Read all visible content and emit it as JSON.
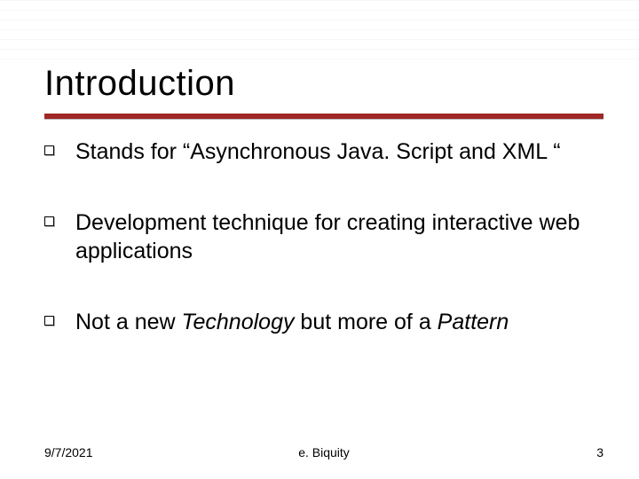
{
  "title": "Introduction",
  "bullets": [
    {
      "html": "Stands for “Asynchronous Java. Script and XML “"
    },
    {
      "html": "Development technique for creating interactive web applications"
    },
    {
      "html": "Not a new <em>Technology</em> but more of a <em>Pattern</em>"
    }
  ],
  "footer": {
    "date": "9/7/2021",
    "center": "e. Biquity",
    "page": "3"
  },
  "colors": {
    "accent": "#a02828"
  }
}
